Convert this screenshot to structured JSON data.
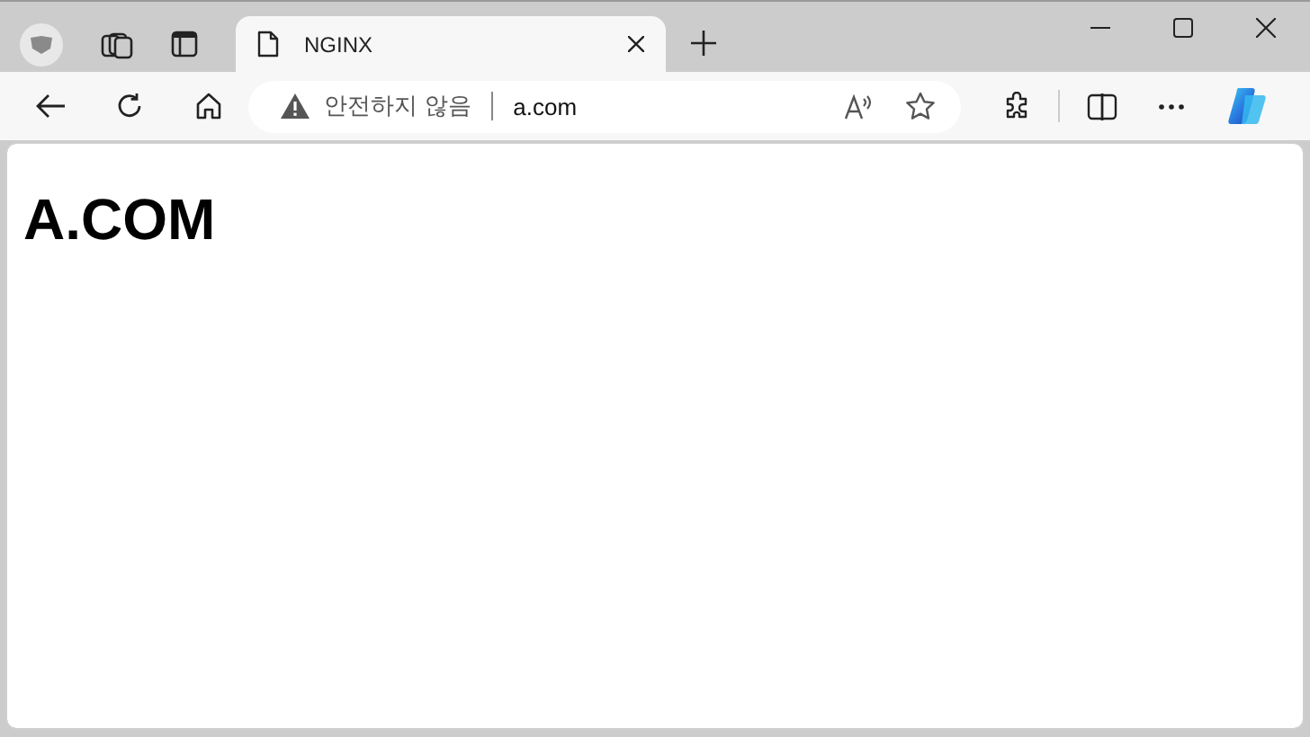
{
  "tabs": [
    {
      "title": "NGINX",
      "selected": true
    }
  ],
  "address_bar": {
    "security_label": "안전하지 않음",
    "url": "a.com"
  },
  "page": {
    "heading": "A.COM"
  }
}
